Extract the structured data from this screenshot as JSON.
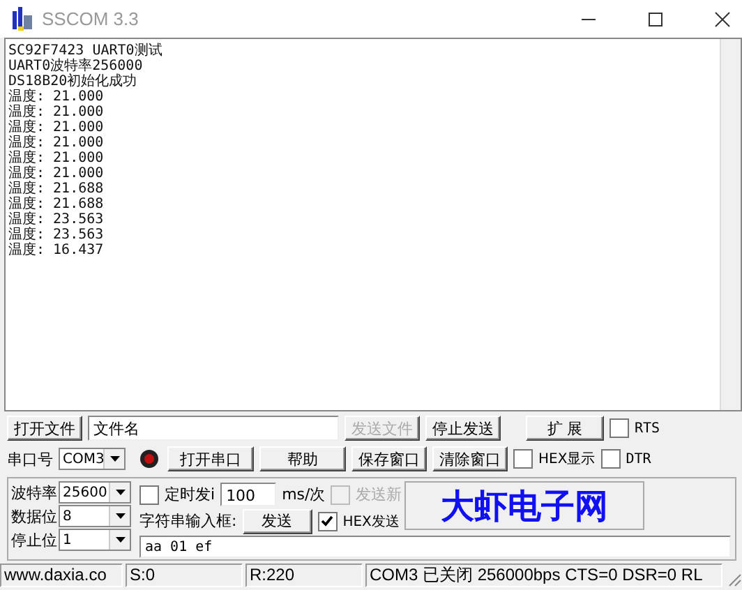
{
  "window": {
    "title": "SSCOM 3.3"
  },
  "receive_lines": [
    "SC92F7423 UART0测试",
    "UART0波特率256000",
    "DS18B20初始化成功",
    "温度: 21.000",
    "温度: 21.000",
    "温度: 21.000",
    "温度: 21.000",
    "温度: 21.000",
    "温度: 21.000",
    "温度: 21.688",
    "温度: 21.688",
    "温度: 23.563",
    "温度: 23.563",
    "温度: 16.437"
  ],
  "row1": {
    "open_file": {
      "label": "打开文件",
      "disabled": false
    },
    "file_name": {
      "value": "文件名"
    },
    "send_file": {
      "label": "发送文件",
      "disabled": true
    },
    "stop_send": {
      "label": "停止发送",
      "disabled": false
    },
    "expand": {
      "label": "扩 展",
      "disabled": false
    },
    "rts": {
      "label": "RTS",
      "checked": false
    }
  },
  "row2": {
    "port_label": "串口号",
    "port": {
      "value": "COM3"
    },
    "port_open": false,
    "open_port": {
      "label": "打开串口"
    },
    "help": {
      "label": "帮助"
    },
    "save_window": {
      "label": "保存窗口"
    },
    "clear_window": {
      "label": "清除窗口"
    },
    "hex_display": {
      "label": "HEX显示",
      "checked": false
    },
    "dtr": {
      "label": "DTR",
      "checked": false
    }
  },
  "settings": [
    {
      "label": "波特率",
      "value": "25600"
    },
    {
      "label": "数据位",
      "value": "8"
    },
    {
      "label": "停止位",
      "value": "1"
    }
  ],
  "timed_send": {
    "label": "定时发i",
    "checked": false,
    "interval": "100",
    "unit": "ms/次"
  },
  "send_newline": {
    "label": "发送新",
    "checked": false,
    "disabled": true
  },
  "string_input_label": "字符串输入框:",
  "send_button": {
    "label": "发送"
  },
  "hex_send": {
    "label": "HEX发送",
    "checked": true
  },
  "banner": "大虾电子网",
  "send_text": {
    "value": "aa 01 ef"
  },
  "status_bar": [
    "www.daxia.co",
    "S:0",
    "R:220",
    "COM3 已关闭  256000bps  CTS=0 DSR=0 RL"
  ]
}
